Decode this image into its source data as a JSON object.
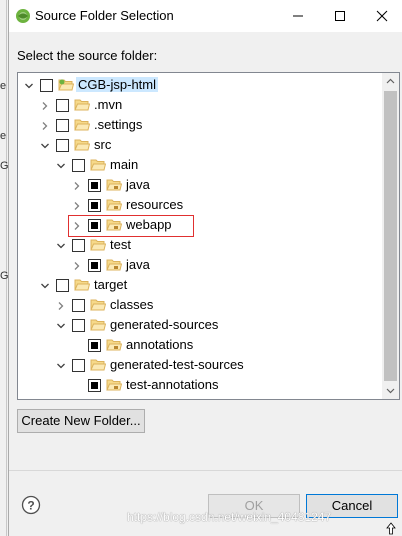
{
  "background_fragments": [
    "e",
    "e",
    "G",
    "G"
  ],
  "window": {
    "title": "Source Folder Selection"
  },
  "content": {
    "prompt": "Select the source folder:"
  },
  "tree": {
    "selected_index": 0,
    "highlight_index": 8,
    "items": [
      {
        "label": "CGB-jsp-html",
        "depth": 0,
        "expanded": true,
        "has_arrow": true,
        "checkbox": "unchecked",
        "folder": "project"
      },
      {
        "label": ".mvn",
        "depth": 1,
        "expanded": false,
        "has_arrow": true,
        "checkbox": "unchecked",
        "folder": "folder"
      },
      {
        "label": ".settings",
        "depth": 1,
        "expanded": false,
        "has_arrow": true,
        "checkbox": "unchecked",
        "folder": "folder"
      },
      {
        "label": "src",
        "depth": 1,
        "expanded": true,
        "has_arrow": true,
        "checkbox": "unchecked",
        "folder": "folder"
      },
      {
        "label": "main",
        "depth": 2,
        "expanded": true,
        "has_arrow": true,
        "checkbox": "unchecked",
        "folder": "folder"
      },
      {
        "label": "java",
        "depth": 3,
        "expanded": false,
        "has_arrow": true,
        "checkbox": "partial",
        "folder": "source"
      },
      {
        "label": "resources",
        "depth": 3,
        "expanded": false,
        "has_arrow": true,
        "checkbox": "partial",
        "folder": "source"
      },
      {
        "label": "webapp",
        "depth": 3,
        "expanded": false,
        "has_arrow": true,
        "checkbox": "partial",
        "folder": "source"
      },
      {
        "label": "test",
        "depth": 2,
        "expanded": true,
        "has_arrow": true,
        "checkbox": "unchecked",
        "folder": "folder"
      },
      {
        "label": "java",
        "depth": 3,
        "expanded": false,
        "has_arrow": true,
        "checkbox": "partial",
        "folder": "source"
      },
      {
        "label": "target",
        "depth": 1,
        "expanded": true,
        "has_arrow": true,
        "checkbox": "unchecked",
        "folder": "folder"
      },
      {
        "label": "classes",
        "depth": 2,
        "expanded": false,
        "has_arrow": true,
        "checkbox": "unchecked",
        "folder": "folder"
      },
      {
        "label": "generated-sources",
        "depth": 2,
        "expanded": true,
        "has_arrow": true,
        "checkbox": "unchecked",
        "folder": "folder"
      },
      {
        "label": "annotations",
        "depth": 3,
        "expanded": false,
        "has_arrow": false,
        "checkbox": "partial",
        "folder": "source"
      },
      {
        "label": "generated-test-sources",
        "depth": 2,
        "expanded": true,
        "has_arrow": true,
        "checkbox": "unchecked",
        "folder": "folder"
      },
      {
        "label": "test-annotations",
        "depth": 3,
        "expanded": false,
        "has_arrow": false,
        "checkbox": "partial",
        "folder": "source"
      }
    ]
  },
  "buttons": {
    "create_new_folder": "Create New Folder...",
    "ok": "OK",
    "cancel": "Cancel"
  },
  "watermark": "https://blog.csdn.net/weixin_40481247",
  "colors": {
    "selection": "#cce8ff",
    "highlight_box": "#e03030",
    "folder": "#dcb35c",
    "source_package": "#b8862f",
    "default_button_border": "#0078d7"
  }
}
